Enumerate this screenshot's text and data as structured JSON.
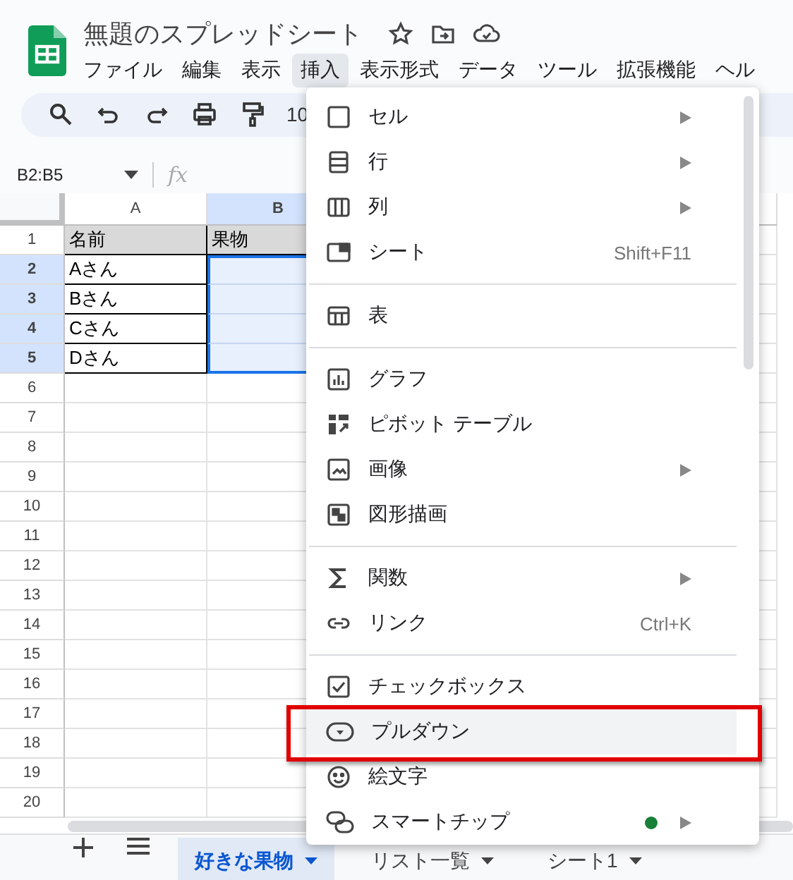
{
  "app": {
    "title": "無題のスプレッドシート"
  },
  "menubar": [
    {
      "label": "ファイル",
      "selected": false
    },
    {
      "label": "編集",
      "selected": false
    },
    {
      "label": "表示",
      "selected": false
    },
    {
      "label": "挿入",
      "selected": true
    },
    {
      "label": "表示形式",
      "selected": false
    },
    {
      "label": "データ",
      "selected": false
    },
    {
      "label": "ツール",
      "selected": false
    },
    {
      "label": "拡張機能",
      "selected": false
    },
    {
      "label": "ヘル",
      "selected": false
    }
  ],
  "toolbar": {
    "zoom": "10"
  },
  "formula_bar": {
    "name_box": "B2:B5",
    "function_label": "fx"
  },
  "grid": {
    "columns": [
      {
        "label": "A",
        "selected": false
      },
      {
        "label": "B",
        "selected": true
      }
    ],
    "rows": [
      {
        "number": "1",
        "selected": false,
        "kind": "header",
        "cells": [
          {
            "text": "名前",
            "selected": false
          },
          {
            "text": "果物",
            "selected": false
          }
        ]
      },
      {
        "number": "2",
        "selected": true,
        "kind": "data",
        "cells": [
          {
            "text": "Aさん",
            "selected": false
          },
          {
            "selected": true
          }
        ]
      },
      {
        "number": "3",
        "selected": true,
        "kind": "data",
        "cells": [
          {
            "text": "Bさん",
            "selected": false
          },
          {
            "selected": true
          }
        ]
      },
      {
        "number": "4",
        "selected": true,
        "kind": "data",
        "cells": [
          {
            "text": "Cさん",
            "selected": false
          },
          {
            "selected": true
          }
        ]
      },
      {
        "number": "5",
        "selected": true,
        "kind": "data",
        "cells": [
          {
            "text": "Dさん",
            "selected": false
          },
          {
            "selected": true
          }
        ]
      },
      {
        "number": "6",
        "selected": false
      },
      {
        "number": "7",
        "selected": false
      },
      {
        "number": "8",
        "selected": false
      },
      {
        "number": "9",
        "selected": false
      },
      {
        "number": "10",
        "selected": false
      },
      {
        "number": "11",
        "selected": false
      },
      {
        "number": "12",
        "selected": false
      },
      {
        "number": "13",
        "selected": false
      },
      {
        "number": "14",
        "selected": false
      },
      {
        "number": "15",
        "selected": false
      },
      {
        "number": "16",
        "selected": false
      },
      {
        "number": "17",
        "selected": false
      },
      {
        "number": "18",
        "selected": false
      },
      {
        "number": "19",
        "selected": false
      },
      {
        "number": "20",
        "selected": false
      }
    ]
  },
  "menu": {
    "sections": [
      [
        {
          "label": "セル",
          "submenu": true,
          "highlighted": false
        },
        {
          "label": "行",
          "submenu": true,
          "highlighted": false
        },
        {
          "label": "列",
          "submenu": true,
          "highlighted": false
        },
        {
          "label": "シート",
          "shortcut": "Shift+F11",
          "submenu": false,
          "highlighted": false
        }
      ],
      [
        {
          "label": "表",
          "submenu": false,
          "highlighted": false
        }
      ],
      [
        {
          "label": "グラフ",
          "submenu": false,
          "highlighted": false
        },
        {
          "label": "ピボット テーブル",
          "submenu": false,
          "highlighted": false
        },
        {
          "label": "画像",
          "submenu": true,
          "highlighted": false
        },
        {
          "label": "図形描画",
          "submenu": false,
          "highlighted": false
        }
      ],
      [
        {
          "label": "関数",
          "submenu": true,
          "highlighted": false
        },
        {
          "label": "リンク",
          "shortcut": "Ctrl+K",
          "submenu": false,
          "highlighted": false
        }
      ],
      [
        {
          "label": "チェックボックス",
          "submenu": false,
          "highlighted": false
        },
        {
          "label": "プルダウン",
          "submenu": false,
          "highlighted": true,
          "annotated": true
        },
        {
          "label": "絵文字",
          "submenu": false,
          "highlighted": false
        },
        {
          "label": "スマートチップ",
          "submenu": true,
          "highlighted": false,
          "color": "#188038"
        }
      ]
    ]
  },
  "sheet_tabs": [
    {
      "label": "好きな果物",
      "selected": true
    },
    {
      "label": "リスト一覧",
      "selected": false
    },
    {
      "label": "シート1",
      "selected": false
    }
  ]
}
